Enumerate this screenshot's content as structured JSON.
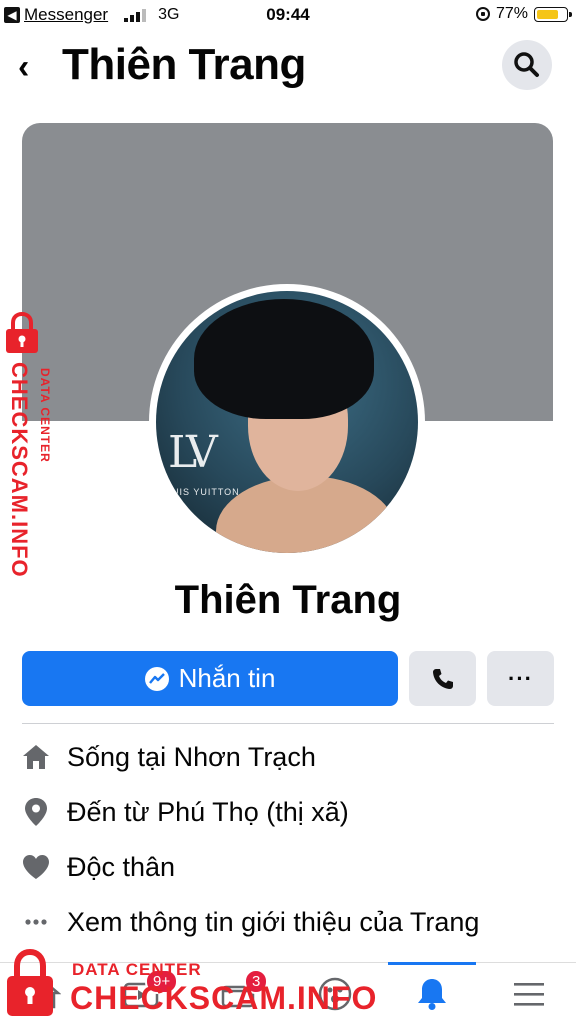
{
  "status_bar": {
    "back_app": "Messenger",
    "network": "3G",
    "time": "09:44",
    "battery": "77%",
    "battery_level": 0.77
  },
  "header": {
    "title": "Thiên Trang"
  },
  "profile": {
    "name": "Thiên Trang",
    "avatar_logo": "LV",
    "avatar_brand": "UIS YUITTON"
  },
  "actions": {
    "message_label": "Nhắn tin",
    "more_label": "···"
  },
  "info": [
    {
      "icon": "home-icon",
      "prefix": "Sống tại ",
      "value": "Nhơn Trạch"
    },
    {
      "icon": "location-pin-icon",
      "prefix": "Đến từ ",
      "value": "Phú Thọ (thị xã)"
    },
    {
      "icon": "heart-icon",
      "prefix": "",
      "value": "Độc thân"
    },
    {
      "icon": "more-dots-icon",
      "prefix": "",
      "value": "Xem thông tin giới thiệu của Trang"
    }
  ],
  "nav": {
    "watch_badge": "9+",
    "marketplace_badge": "3"
  },
  "watermark": {
    "line1": "DATA CENTER",
    "line2": "CHECKSCAM.INFO"
  },
  "colors": {
    "accent": "#1877f2",
    "cover": "#8a8d91",
    "badge": "#e41e3f",
    "watermark": "#e8232b"
  }
}
